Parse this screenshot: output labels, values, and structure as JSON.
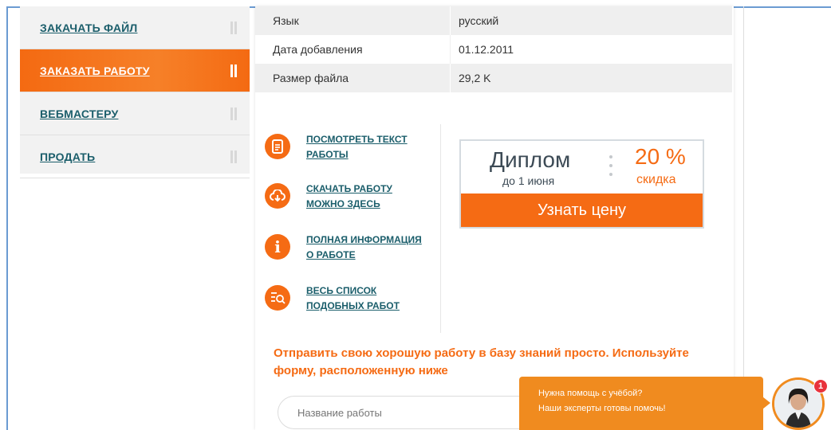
{
  "nav": {
    "items": [
      {
        "label": "ЗАКАЧАТЬ ФАЙЛ",
        "active": false
      },
      {
        "label": "ЗАКАЗАТЬ РАБОТУ",
        "active": true
      },
      {
        "label": "ВЕБМАСТЕРУ",
        "active": false
      },
      {
        "label": "ПРОДАТЬ",
        "active": false
      }
    ]
  },
  "info": {
    "rows": [
      {
        "key": "Язык",
        "value": "русский"
      },
      {
        "key": "Дата добавления",
        "value": "01.12.2011"
      },
      {
        "key": "Размер файла",
        "value": "29,2 K"
      }
    ]
  },
  "links": [
    {
      "icon": "document-icon",
      "text": "ПОСМОТРЕТЬ ТЕКСТ РАБОТЫ"
    },
    {
      "icon": "cloud-download-icon",
      "text": "СКАЧАТЬ РАБОТУ МОЖНО ЗДЕСЬ"
    },
    {
      "icon": "info-icon",
      "text": "ПОЛНАЯ ИНФОРМАЦИЯ О РАБОТЕ"
    },
    {
      "icon": "list-search-icon",
      "text": "ВЕСЬ СПИСОК ПОДОБНЫХ РАБОТ"
    }
  ],
  "banner": {
    "title": "Диплом",
    "subtitle": "до 1 июня",
    "percent": "20 %",
    "discount": "скидка",
    "button": "Узнать цену"
  },
  "promo": "Отправить свою хорошую работу в базу знаний просто. Используйте форму, расположенную ниже",
  "form": {
    "name_placeholder": "Название работы"
  },
  "help": {
    "line1": "Нужна помощь с учёбой?",
    "line2": "Наши эксперты готовы помочь!",
    "badge": "1"
  },
  "colors": {
    "accent": "#f56b14",
    "link": "#1b5e6b",
    "help": "#f08b1f"
  }
}
